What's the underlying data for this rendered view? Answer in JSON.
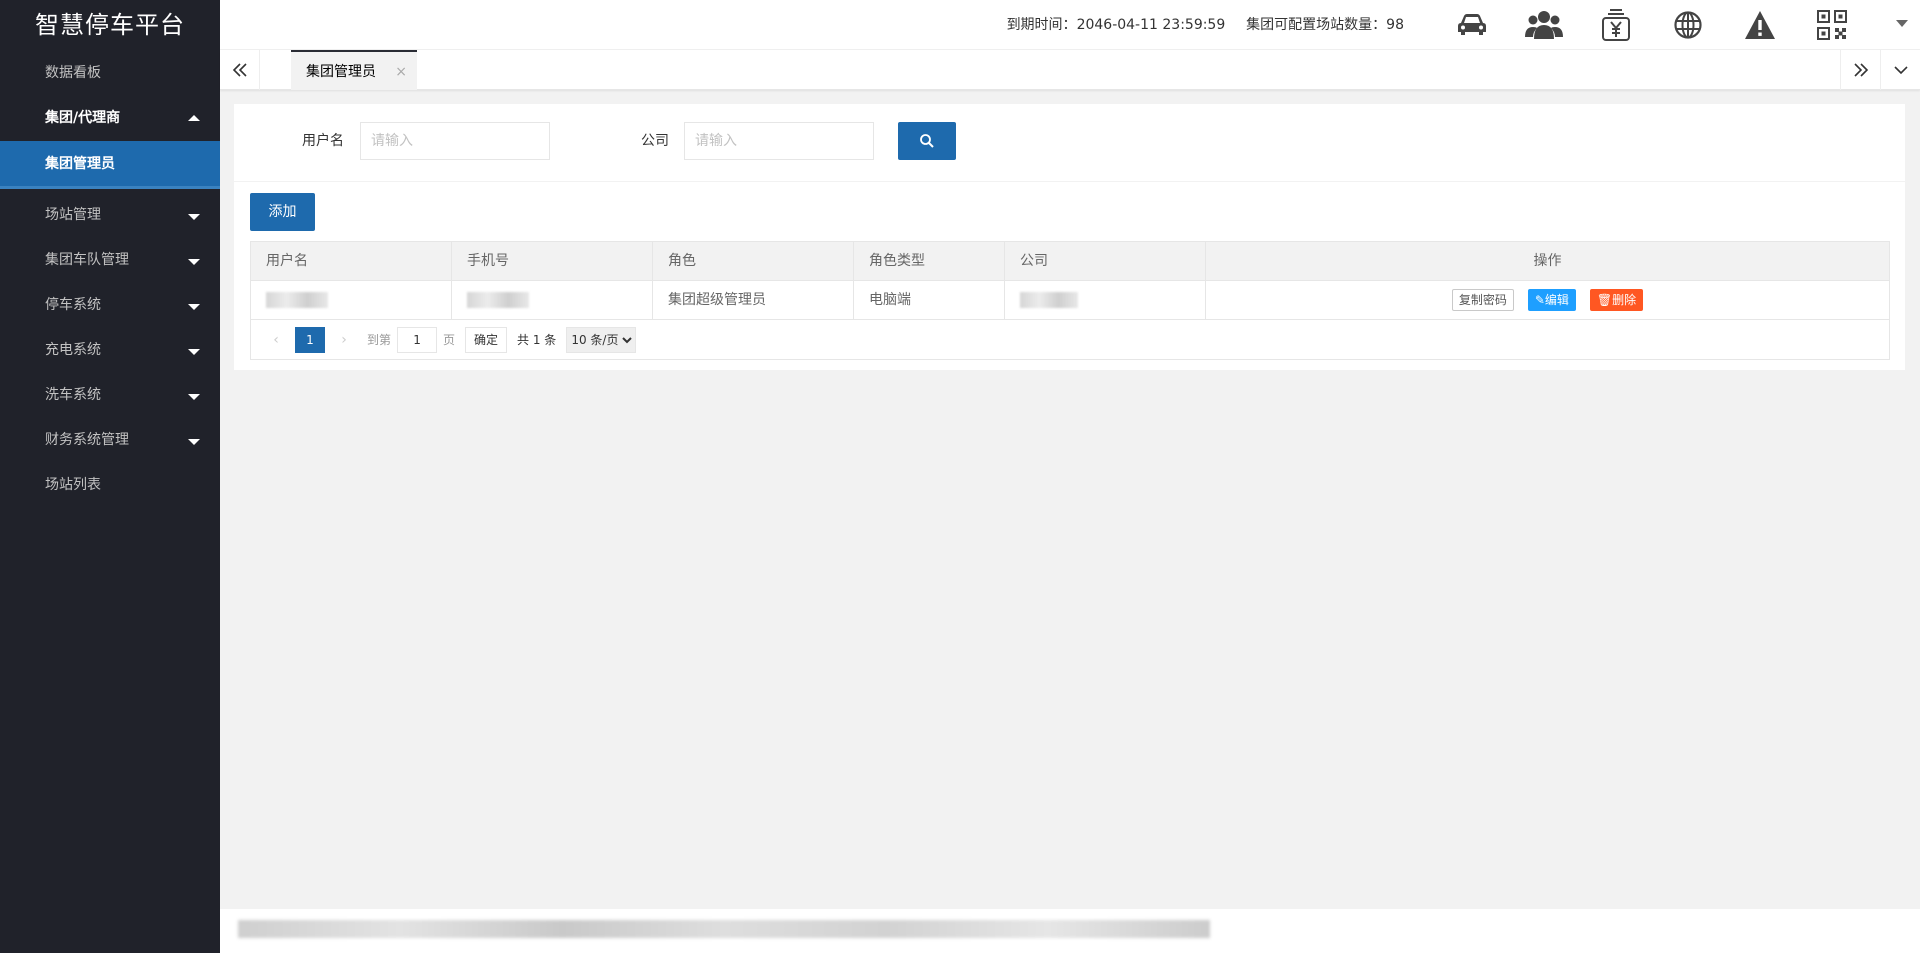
{
  "app": {
    "title": "智慧停车平台"
  },
  "sidebar": {
    "items": [
      {
        "label": "数据看板"
      },
      {
        "label": "集团/代理商"
      },
      {
        "label": "集团管理员"
      },
      {
        "label": "场站管理"
      },
      {
        "label": "集团车队管理"
      },
      {
        "label": "停车系统"
      },
      {
        "label": "充电系统"
      },
      {
        "label": "洗车系统"
      },
      {
        "label": "财务系统管理"
      },
      {
        "label": "场站列表"
      }
    ]
  },
  "header": {
    "expire_label": "到期时间：",
    "expire_value": "2046-04-11 23:59:59",
    "stations_label": "集团可配置场站数量：",
    "stations_value": "98",
    "icons": [
      "car-icon",
      "users-icon",
      "yen-bag-icon",
      "globe-icon",
      "warning-icon",
      "qrcode-icon"
    ]
  },
  "tabs": [
    {
      "label": "集团管理员",
      "close": "×"
    }
  ],
  "search": {
    "username_label": "用户名",
    "username_placeholder": "请输入",
    "company_label": "公司",
    "company_placeholder": "请输入"
  },
  "toolbar": {
    "add_label": "添加"
  },
  "table": {
    "columns": [
      "用户名",
      "手机号",
      "角色",
      "角色类型",
      "公司",
      "操作"
    ],
    "rows": [
      {
        "role": "集团超级管理员",
        "role_type": "电脑端"
      }
    ],
    "actions": {
      "copy": "复制密码",
      "edit": "编辑",
      "delete": "删除"
    }
  },
  "pagination": {
    "prev": "‹",
    "current": "1",
    "next": "›",
    "goto_label": "到第",
    "goto_value": "1",
    "page_unit": "页",
    "confirm": "确定",
    "total": "共 1 条",
    "page_size": "10 条/页"
  },
  "colors": {
    "sidebar_bg": "#20222a",
    "primary": "#1e6aad",
    "edit": "#1e9fff",
    "delete": "#ff5722"
  }
}
